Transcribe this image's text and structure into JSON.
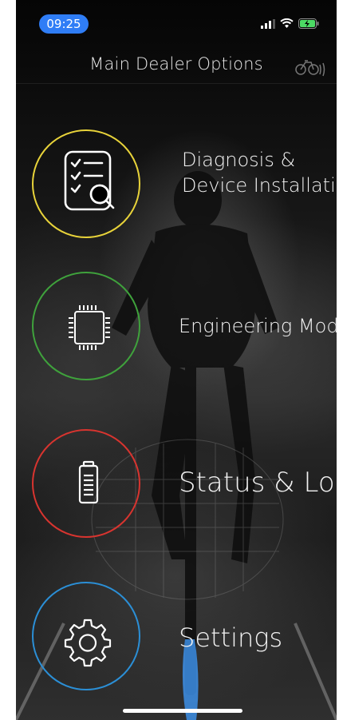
{
  "status_bar": {
    "time": "09:25",
    "time_pill_color": "#2f7df6",
    "icons": [
      "signal-bars-icon",
      "wifi-icon",
      "battery-charging-icon"
    ]
  },
  "header": {
    "title": "Main Dealer Options",
    "right_icon": "bike-connection-icon"
  },
  "options": [
    {
      "id": "diagnosis",
      "label_line1": "Diagnosis &",
      "label_line2": "Device Installation",
      "icon": "checklist-search-icon",
      "ring_color": "#e8d33a"
    },
    {
      "id": "engineering",
      "label_line1": "Engineering Mode",
      "icon": "chip-icon",
      "ring_color": "#3fa23c"
    },
    {
      "id": "status",
      "label_line1": "Status & Log",
      "icon": "battery-icon",
      "ring_color": "#d8342f"
    },
    {
      "id": "settings",
      "label_line1": "Settings",
      "icon": "gear-icon",
      "ring_color": "#2b8fd6"
    }
  ]
}
